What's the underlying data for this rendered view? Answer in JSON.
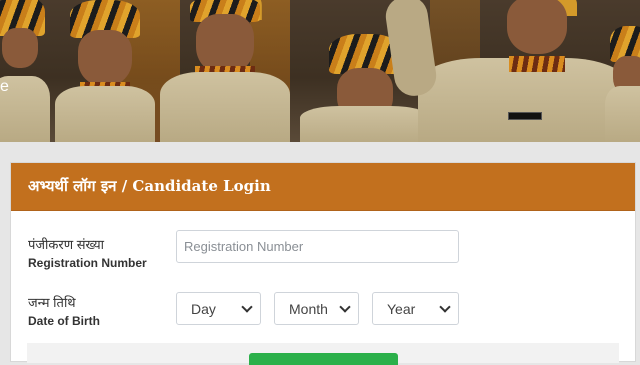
{
  "hero": {
    "partial_text": "e"
  },
  "login": {
    "title": "अभ्यर्थी लॉग इन / Candidate Login",
    "registration": {
      "label_hi": "पंजीकरण संख्या",
      "label_en": "Registration Number",
      "placeholder": "Registration Number",
      "value": ""
    },
    "dob": {
      "label_hi": "जन्म तिथि",
      "label_en": "Date of Birth",
      "day": "Day",
      "month": "Month",
      "year": "Year"
    }
  },
  "colors": {
    "header": "#c2701e",
    "submit": "#2bb04a",
    "page_bg": "#e6e6e6"
  }
}
